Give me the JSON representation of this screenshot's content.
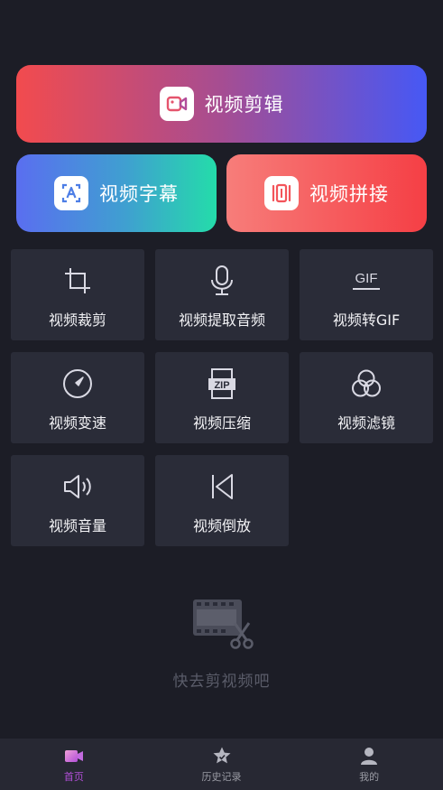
{
  "featured": {
    "edit_label": "视频剪辑",
    "subtitle_label": "视频字幕",
    "concat_label": "视频拼接"
  },
  "tools": [
    {
      "label": "视频裁剪",
      "icon": "crop-icon"
    },
    {
      "label": "视频提取音频",
      "icon": "microphone-icon"
    },
    {
      "label": "视频转GIF",
      "icon": "gif-icon"
    },
    {
      "label": "视频变速",
      "icon": "speed-icon"
    },
    {
      "label": "视频压缩",
      "icon": "zip-icon"
    },
    {
      "label": "视频滤镜",
      "icon": "filter-icon"
    },
    {
      "label": "视频音量",
      "icon": "volume-icon"
    },
    {
      "label": "视频倒放",
      "icon": "reverse-icon"
    }
  ],
  "gif_icon_text": "GIF",
  "zip_icon_text": "ZIP",
  "empty_state": {
    "text": "快去剪视频吧",
    "icon": "film-scissors-icon"
  },
  "bottom_nav": [
    {
      "label": "首页",
      "icon": "home-video-icon",
      "active": true
    },
    {
      "label": "历史记录",
      "icon": "star-history-icon",
      "active": false
    },
    {
      "label": "我的",
      "icon": "user-icon",
      "active": false
    }
  ],
  "colors": {
    "background": "#1c1d26",
    "tile": "#2a2c38",
    "active_tab": "#b24fd8",
    "edit_gradient": [
      "#f24b4e",
      "#4658f5"
    ],
    "subtitle_gradient": [
      "#5a6ef0",
      "#24dcaa"
    ],
    "concat_gradient": [
      "#f77d7a",
      "#f53f45"
    ]
  }
}
